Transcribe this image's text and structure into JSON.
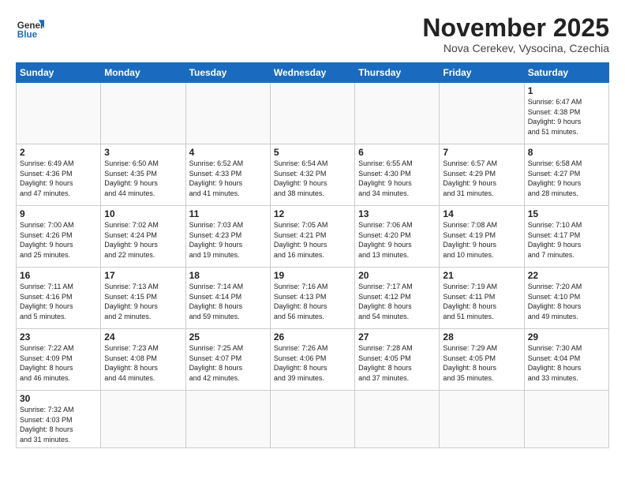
{
  "header": {
    "logo_general": "General",
    "logo_blue": "Blue",
    "month_title": "November 2025",
    "location": "Nova Cerekev, Vysocina, Czechia"
  },
  "days_of_week": [
    "Sunday",
    "Monday",
    "Tuesday",
    "Wednesday",
    "Thursday",
    "Friday",
    "Saturday"
  ],
  "weeks": [
    [
      {
        "day": "",
        "info": ""
      },
      {
        "day": "",
        "info": ""
      },
      {
        "day": "",
        "info": ""
      },
      {
        "day": "",
        "info": ""
      },
      {
        "day": "",
        "info": ""
      },
      {
        "day": "",
        "info": ""
      },
      {
        "day": "1",
        "info": "Sunrise: 6:47 AM\nSunset: 4:38 PM\nDaylight: 9 hours\nand 51 minutes."
      }
    ],
    [
      {
        "day": "2",
        "info": "Sunrise: 6:49 AM\nSunset: 4:36 PM\nDaylight: 9 hours\nand 47 minutes."
      },
      {
        "day": "3",
        "info": "Sunrise: 6:50 AM\nSunset: 4:35 PM\nDaylight: 9 hours\nand 44 minutes."
      },
      {
        "day": "4",
        "info": "Sunrise: 6:52 AM\nSunset: 4:33 PM\nDaylight: 9 hours\nand 41 minutes."
      },
      {
        "day": "5",
        "info": "Sunrise: 6:54 AM\nSunset: 4:32 PM\nDaylight: 9 hours\nand 38 minutes."
      },
      {
        "day": "6",
        "info": "Sunrise: 6:55 AM\nSunset: 4:30 PM\nDaylight: 9 hours\nand 34 minutes."
      },
      {
        "day": "7",
        "info": "Sunrise: 6:57 AM\nSunset: 4:29 PM\nDaylight: 9 hours\nand 31 minutes."
      },
      {
        "day": "8",
        "info": "Sunrise: 6:58 AM\nSunset: 4:27 PM\nDaylight: 9 hours\nand 28 minutes."
      }
    ],
    [
      {
        "day": "9",
        "info": "Sunrise: 7:00 AM\nSunset: 4:26 PM\nDaylight: 9 hours\nand 25 minutes."
      },
      {
        "day": "10",
        "info": "Sunrise: 7:02 AM\nSunset: 4:24 PM\nDaylight: 9 hours\nand 22 minutes."
      },
      {
        "day": "11",
        "info": "Sunrise: 7:03 AM\nSunset: 4:23 PM\nDaylight: 9 hours\nand 19 minutes."
      },
      {
        "day": "12",
        "info": "Sunrise: 7:05 AM\nSunset: 4:21 PM\nDaylight: 9 hours\nand 16 minutes."
      },
      {
        "day": "13",
        "info": "Sunrise: 7:06 AM\nSunset: 4:20 PM\nDaylight: 9 hours\nand 13 minutes."
      },
      {
        "day": "14",
        "info": "Sunrise: 7:08 AM\nSunset: 4:19 PM\nDaylight: 9 hours\nand 10 minutes."
      },
      {
        "day": "15",
        "info": "Sunrise: 7:10 AM\nSunset: 4:17 PM\nDaylight: 9 hours\nand 7 minutes."
      }
    ],
    [
      {
        "day": "16",
        "info": "Sunrise: 7:11 AM\nSunset: 4:16 PM\nDaylight: 9 hours\nand 5 minutes."
      },
      {
        "day": "17",
        "info": "Sunrise: 7:13 AM\nSunset: 4:15 PM\nDaylight: 9 hours\nand 2 minutes."
      },
      {
        "day": "18",
        "info": "Sunrise: 7:14 AM\nSunset: 4:14 PM\nDaylight: 8 hours\nand 59 minutes."
      },
      {
        "day": "19",
        "info": "Sunrise: 7:16 AM\nSunset: 4:13 PM\nDaylight: 8 hours\nand 56 minutes."
      },
      {
        "day": "20",
        "info": "Sunrise: 7:17 AM\nSunset: 4:12 PM\nDaylight: 8 hours\nand 54 minutes."
      },
      {
        "day": "21",
        "info": "Sunrise: 7:19 AM\nSunset: 4:11 PM\nDaylight: 8 hours\nand 51 minutes."
      },
      {
        "day": "22",
        "info": "Sunrise: 7:20 AM\nSunset: 4:10 PM\nDaylight: 8 hours\nand 49 minutes."
      }
    ],
    [
      {
        "day": "23",
        "info": "Sunrise: 7:22 AM\nSunset: 4:09 PM\nDaylight: 8 hours\nand 46 minutes."
      },
      {
        "day": "24",
        "info": "Sunrise: 7:23 AM\nSunset: 4:08 PM\nDaylight: 8 hours\nand 44 minutes."
      },
      {
        "day": "25",
        "info": "Sunrise: 7:25 AM\nSunset: 4:07 PM\nDaylight: 8 hours\nand 42 minutes."
      },
      {
        "day": "26",
        "info": "Sunrise: 7:26 AM\nSunset: 4:06 PM\nDaylight: 8 hours\nand 39 minutes."
      },
      {
        "day": "27",
        "info": "Sunrise: 7:28 AM\nSunset: 4:05 PM\nDaylight: 8 hours\nand 37 minutes."
      },
      {
        "day": "28",
        "info": "Sunrise: 7:29 AM\nSunset: 4:05 PM\nDaylight: 8 hours\nand 35 minutes."
      },
      {
        "day": "29",
        "info": "Sunrise: 7:30 AM\nSunset: 4:04 PM\nDaylight: 8 hours\nand 33 minutes."
      }
    ],
    [
      {
        "day": "30",
        "info": "Sunrise: 7:32 AM\nSunset: 4:03 PM\nDaylight: 8 hours\nand 31 minutes."
      },
      {
        "day": "",
        "info": ""
      },
      {
        "day": "",
        "info": ""
      },
      {
        "day": "",
        "info": ""
      },
      {
        "day": "",
        "info": ""
      },
      {
        "day": "",
        "info": ""
      },
      {
        "day": "",
        "info": ""
      }
    ]
  ]
}
